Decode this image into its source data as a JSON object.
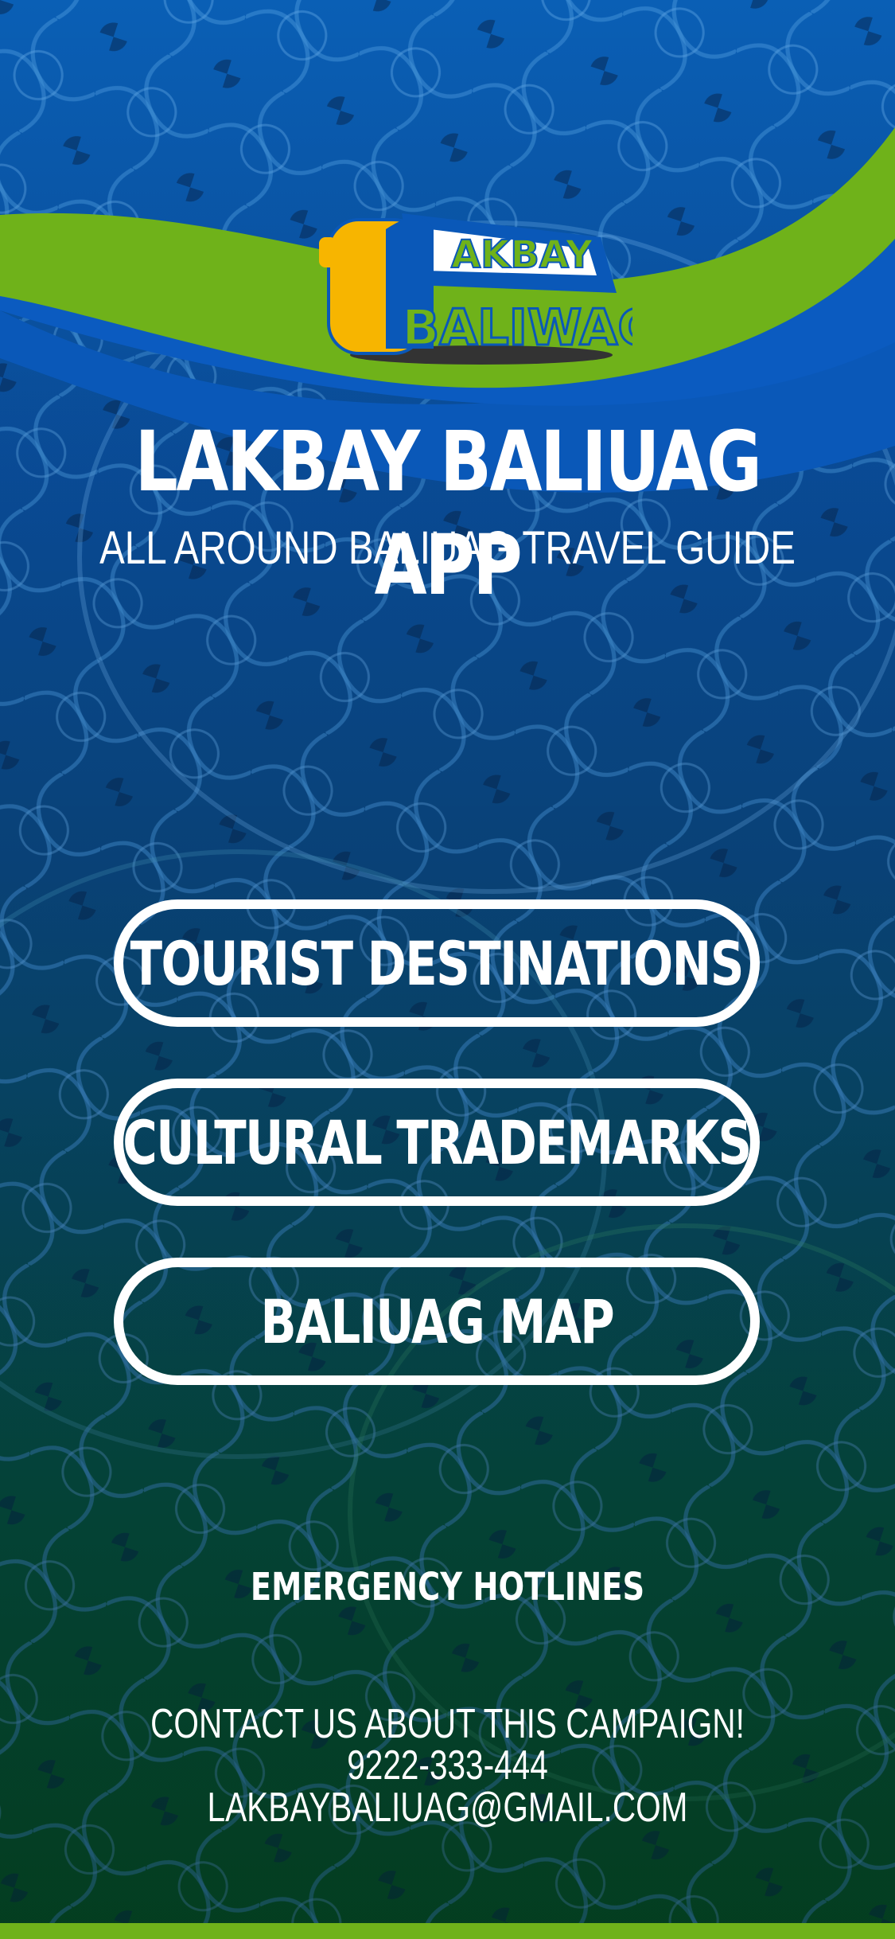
{
  "header": {
    "logo_line1": "AKBAY",
    "logo_line2": "BALIWAG",
    "title": "LAKBAY BALIUAG APP",
    "subtitle": "ALL AROUND BALIUAG TRAVEL GUIDE"
  },
  "menu": {
    "items": [
      {
        "label": "TOURIST DESTINATIONS"
      },
      {
        "label": "CULTURAL TRADEMARKS"
      },
      {
        "label": "BALIUAG MAP"
      }
    ]
  },
  "emergency": {
    "label": "EMERGENCY HOTLINES"
  },
  "contact": {
    "heading": "CONTACT US ABOUT THIS CAMPAIGN!",
    "phone": "9222-333-444",
    "email": "LAKBAYBALIUAG@GMAIL.COM"
  },
  "colors": {
    "brand_green": "#6fb21a",
    "brand_blue": "#0a58b8",
    "logo_yellow": "#f7b500",
    "text": "#ffffff"
  }
}
